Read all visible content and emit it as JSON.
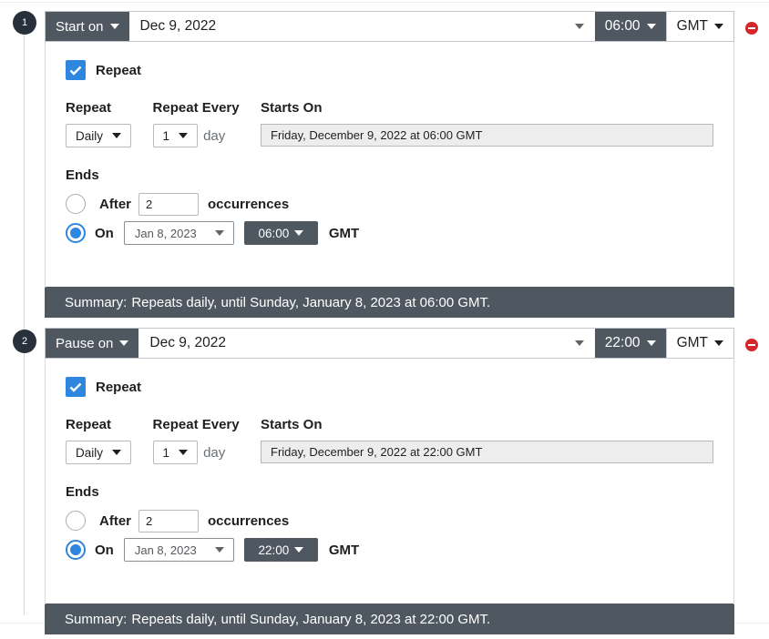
{
  "schedules": [
    {
      "step": "1",
      "mode_label": "Start on",
      "date": "Dec 9, 2022",
      "time": "06:00",
      "timezone": "GMT",
      "repeat_checkbox_label": "Repeat",
      "repeat_checked": true,
      "repeat_label": "Repeat",
      "repeat_value": "Daily",
      "repeat_every_label": "Repeat Every",
      "repeat_every_value": "1",
      "repeat_every_unit": "day",
      "starts_on_label": "Starts On",
      "starts_on_value": "Friday, December 9, 2022 at 06:00 GMT",
      "ends_label": "Ends",
      "after_label": "After",
      "after_value": "2",
      "occurrences_label": "occurrences",
      "on_label": "On",
      "end_date": "Jan 8, 2023",
      "end_time": "06:00",
      "end_timezone": "GMT",
      "selected_end_option": "On",
      "summary_label": "Summary:",
      "summary_text": "Repeats daily, until Sunday, January 8, 2023 at 06:00 GMT."
    },
    {
      "step": "2",
      "mode_label": "Pause on",
      "date": "Dec 9, 2022",
      "time": "22:00",
      "timezone": "GMT",
      "repeat_checkbox_label": "Repeat",
      "repeat_checked": true,
      "repeat_label": "Repeat",
      "repeat_value": "Daily",
      "repeat_every_label": "Repeat Every",
      "repeat_every_value": "1",
      "repeat_every_unit": "day",
      "starts_on_label": "Starts On",
      "starts_on_value": "Friday, December 9, 2022 at 22:00 GMT",
      "ends_label": "Ends",
      "after_label": "After",
      "after_value": "2",
      "occurrences_label": "occurrences",
      "on_label": "On",
      "end_date": "Jan 8, 2023",
      "end_time": "22:00",
      "end_timezone": "GMT",
      "selected_end_option": "On",
      "summary_label": "Summary:",
      "summary_text": "Repeats daily, until Sunday, January 8, 2023 at 22:00 GMT."
    }
  ],
  "colors": {
    "accent_blue": "#2e86de",
    "dark_slate": "#4f5861",
    "remove_red": "#d4272c",
    "step_badge": "#27303b"
  }
}
